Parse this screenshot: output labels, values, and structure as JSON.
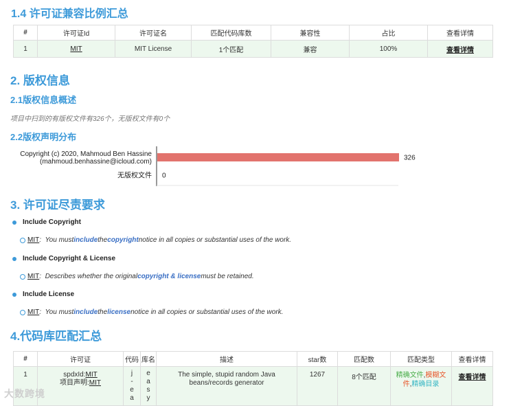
{
  "sec14": {
    "title": "1.4 许可证兼容比例汇总",
    "headers": [
      "#",
      "许可证Id",
      "许可证名",
      "匹配代码库数",
      "兼容性",
      "占比",
      "查看详情"
    ],
    "rows": [
      [
        "1",
        "MIT",
        "MIT License",
        "1个匹配",
        "兼容",
        "100%",
        "查看详情"
      ]
    ]
  },
  "sec2": {
    "title": "2. 版权信息",
    "sub1_title": "2.1版权信息概述",
    "summary": "项目中扫到的有版权文件有326个，无版权文件有0个",
    "sub2_title": "2.2版权声明分布"
  },
  "chart_data": {
    "type": "bar",
    "orientation": "horizontal",
    "categories": [
      "Copyright (c) 2020, Mahmoud Ben Hassine\n(mahmoud.benhassine@icloud.com)",
      "无版权文件"
    ],
    "values": [
      326,
      0
    ],
    "value_labels": [
      "326",
      "0"
    ],
    "bar_color": "#e2736d",
    "xlim": [
      0,
      326
    ],
    "grid": false
  },
  "sec3": {
    "title": "3. 许可证尽责要求",
    "items": [
      {
        "label": "Include Copyright",
        "license": "MIT",
        "parts": [
          "You must ",
          "include",
          " the ",
          "copyright",
          " notice in all copies or substantial uses of the work."
        ]
      },
      {
        "label": "Include Copyright & License",
        "license": "MIT",
        "parts": [
          "Describes whether the original ",
          "copyright & license",
          " must be retained.",
          "",
          ""
        ]
      },
      {
        "label": "Include License",
        "license": "MIT",
        "parts": [
          "You must ",
          "include",
          " the ",
          "license",
          " notice in all copies or substantial uses of the work."
        ]
      }
    ]
  },
  "sec4": {
    "title": "4.代码库匹配汇总",
    "headers": [
      "#",
      "许可证",
      "代码",
      "库名",
      "描述",
      "star数",
      "匹配数",
      "匹配类型",
      "查看详情"
    ],
    "row": {
      "num": "1",
      "spdx_prefix": "spdxId:",
      "spdx_id": "MIT",
      "decl_prefix": "项目声明:",
      "decl_id": "MIT",
      "code": "j-ea",
      "lib": "easy",
      "desc": "The simple, stupid random Java beans/records generator",
      "stars": "1267",
      "matches": "8个匹配",
      "type_a": "精确文件",
      "type_sep1": ",",
      "type_b": "模糊文件",
      "type_sep2": ",",
      "type_c": "精确目录",
      "detail": "查看详情"
    }
  },
  "watermark": "大数跨境"
}
